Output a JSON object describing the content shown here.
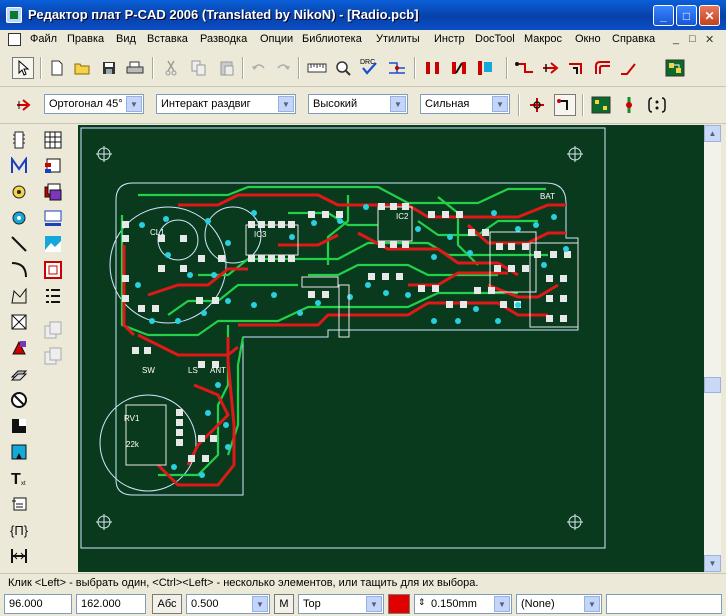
{
  "window": {
    "title": "Редактор плат P-CAD 2006 (Translated by NikoN) - [Radio.pcb]",
    "minimize_glyph": "_",
    "maximize_glyph": "□",
    "close_glyph": "✕"
  },
  "menu": {
    "items": [
      "Файл",
      "Правка",
      "Вид",
      "Вставка",
      "Разводка",
      "Опции",
      "Библиотека",
      "Утилиты",
      "Инстр",
      "DocTool",
      "Макрос",
      "Окно",
      "Справка"
    ],
    "mdi_controls": [
      "_",
      "□",
      "✕"
    ]
  },
  "toolbar_main": {
    "icons": [
      "select-arrow-icon",
      "new-file-icon",
      "open-folder-icon",
      "save-icon",
      "print-icon",
      "cut-icon",
      "copy-icon",
      "paste-icon",
      "undo-icon",
      "redo-icon",
      "ruler-icon",
      "zoom-icon",
      "drc-icon",
      "netlist-icon",
      "route-pad-icon",
      "route-manual-icon",
      "route-highlight-icon",
      "route-bend-icon",
      "route-arrow-icon",
      "route-corner-icon",
      "route-curve-icon",
      "route-diagonal-icon",
      "board-icon"
    ],
    "drc_label": "DRC"
  },
  "toolbar_route": {
    "mode_value": "Ортогонал 45°",
    "interactive_value": "Интеракт раздвиг",
    "level_value": "Высокий",
    "strength_value": "Сильная"
  },
  "canvas": {
    "board_labels": [
      "CL1",
      "IC2",
      "IC3",
      "RV1",
      "BAT",
      "LS",
      "ANT",
      "SW",
      "22k"
    ],
    "colors": {
      "background": "#0a3a1e",
      "outline": "#cfe8ff",
      "top_copper": "#e01818",
      "bottom_copper": "#22d04a",
      "pad": "#e8e8e8",
      "via": "#2ad0e0"
    }
  },
  "status": {
    "hint": "Клик <Left> - выбрать один, <Ctrl><Left> - несколько элементов, или тащить для их выбора.",
    "x_coord": "96.000",
    "y_coord": "162.000",
    "abs_label": "Абс",
    "grid_value": "0.500",
    "m_label": "M",
    "layer_value": "Top",
    "layer_color": "#e00000",
    "width_value": "0.150mm",
    "net_value": "(None)"
  }
}
